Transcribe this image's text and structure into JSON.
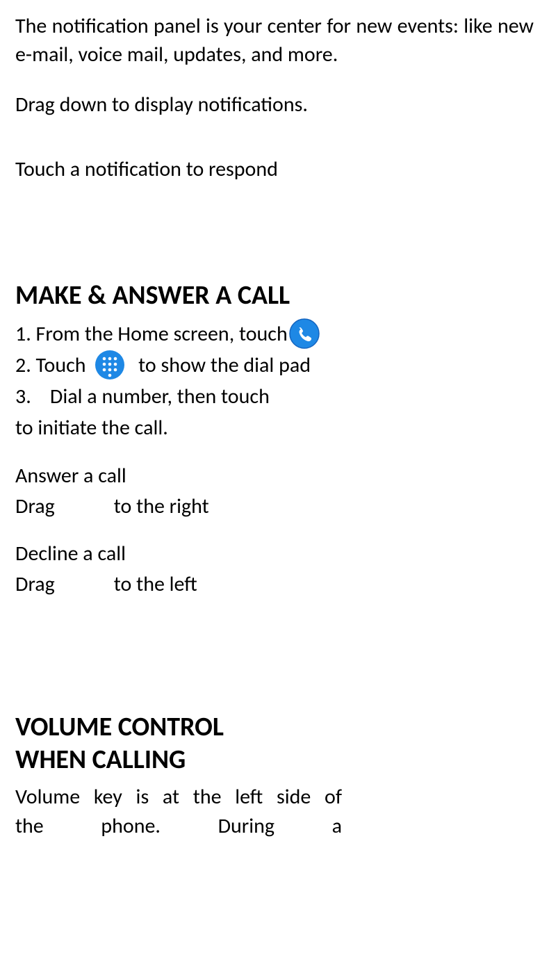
{
  "intro": {
    "p1": "The notification panel is your center for new events: like new e-mail, voice mail, updates, and more.",
    "p2": "Drag down to display notifications.",
    "p3": "Touch a notification to respond"
  },
  "call": {
    "heading": "MAKE & ANSWER A CALL",
    "step1_pre": "1. From the Home screen, touch",
    "step2_pre": "2. Touch ",
    "step2_post": " to show the dial pad",
    "step3_a": "3.    Dial a number, then touch",
    "step3_b": "to initiate the call.",
    "answer_h": "Answer a call",
    "answer_drag_a": "Drag",
    "answer_drag_b": "to the right",
    "decline_h": "Decline a call",
    "decline_drag_a": "Drag",
    "decline_drag_b": "to the left"
  },
  "volume": {
    "heading_l1": "VOLUME CONTROL",
    "heading_l2": "WHEN CALLING",
    "body_l1": "Volume key is at the left side of",
    "body_l2": "the phone. During a"
  },
  "icons": {
    "phone": "phone-icon",
    "dialpad": "dialpad-icon"
  },
  "colors": {
    "icon_blue": "#1e88e5",
    "icon_blue_ring": "#1565c0"
  }
}
